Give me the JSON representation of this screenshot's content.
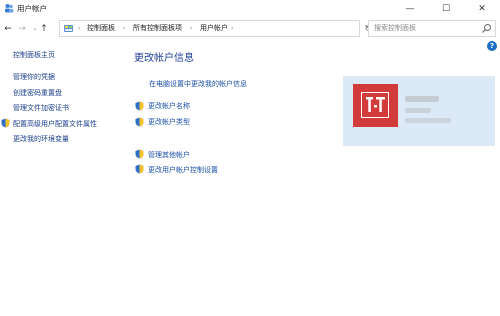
{
  "window": {
    "title": "用户帐户",
    "controls": {
      "minimize": "—",
      "maximize": "☐",
      "close": "✕"
    }
  },
  "address_bar": {
    "back": "←",
    "forward": "→",
    "history": "⌄",
    "up": "↑",
    "breadcrumbs": [
      "控制面板",
      "所有控制面板项",
      "用户帐户"
    ],
    "separator": "›",
    "dropdown": "⌄",
    "refresh": "↻"
  },
  "search": {
    "placeholder": "搜索控制面板"
  },
  "help": {
    "label": "?"
  },
  "sidebar": {
    "home": "控制面板主页",
    "items": [
      {
        "label": "管理你的凭据",
        "shield": false
      },
      {
        "label": "创建密码重置盘",
        "shield": false
      },
      {
        "label": "管理文件加密证书",
        "shield": false
      },
      {
        "label": "配置高级用户配置文件属性",
        "shield": true
      },
      {
        "label": "更改我的环境变量",
        "shield": false
      }
    ]
  },
  "main": {
    "heading": "更改帐户信息",
    "settings_link": "在电脑设置中更改我的帐户信息",
    "change_name": "更改帐户名称",
    "change_type": "更改帐户类型",
    "manage_other": "管理其他帐户",
    "uac_settings": "更改用户帐户控制设置"
  },
  "colors": {
    "link": "#1a4fa8",
    "heading": "#1e3f9a",
    "panel": "#dceaf7",
    "avatar": "#d33a3a"
  }
}
